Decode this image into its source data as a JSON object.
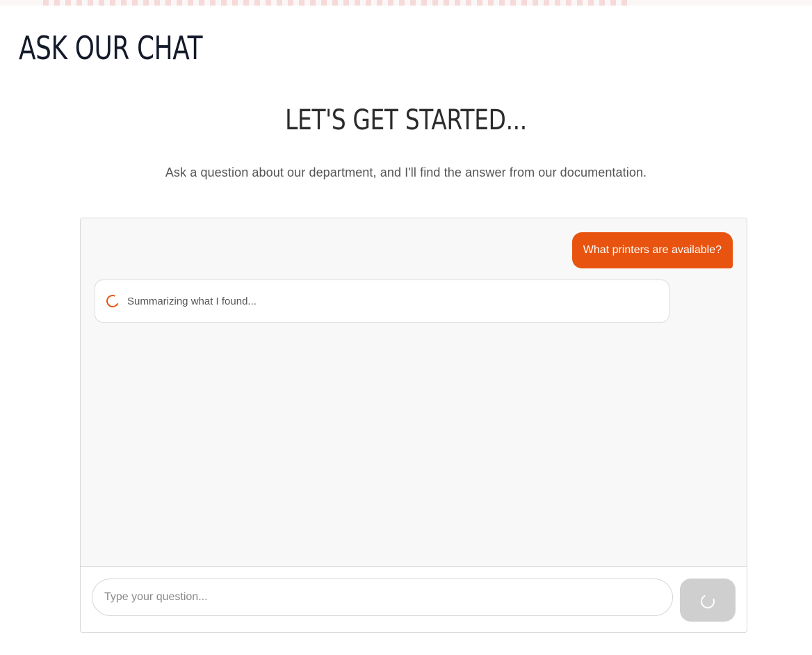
{
  "header": {
    "title": "ASK OUR CHAT"
  },
  "hero": {
    "title": "LET'S GET STARTED...",
    "subtitle": "Ask a question about our department, and I'll find the answer from our documentation."
  },
  "chat": {
    "messages": [
      {
        "role": "user",
        "text": "What printers are available?"
      },
      {
        "role": "assistant",
        "status": "loading",
        "text": "Summarizing what I found..."
      }
    ],
    "input": {
      "placeholder": "Type your question...",
      "value": ""
    },
    "send_button": {
      "state": "loading",
      "icon": "spinner-icon"
    }
  },
  "colors": {
    "accent": "#e8530f",
    "panel_background": "#f8f8f8",
    "button_disabled": "#cfcfcf"
  }
}
